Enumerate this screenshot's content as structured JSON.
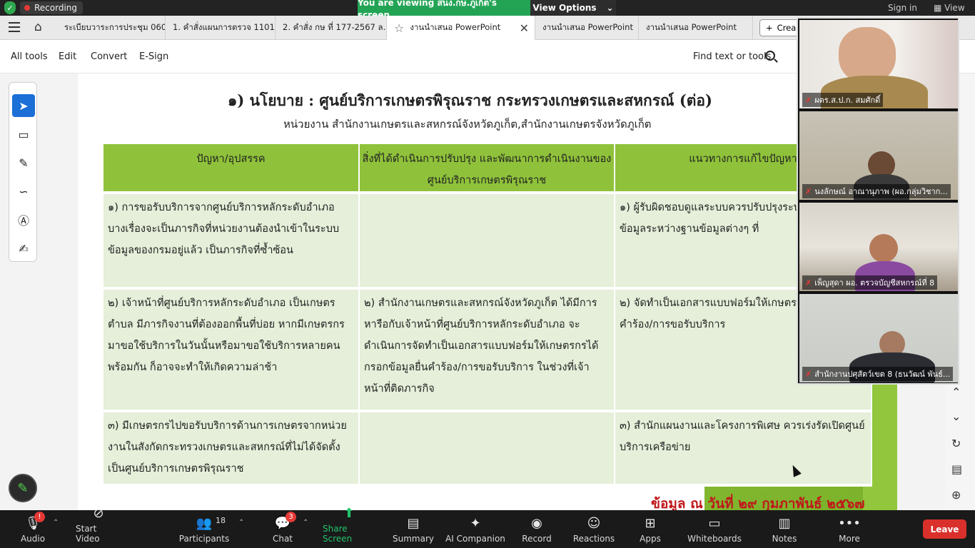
{
  "zoom_top": {
    "recording_label": "Recording",
    "viewing_text": "You are viewing สนง.กษ.ภูเก็ต's screen",
    "view_options_label": "View Options",
    "sign_in": "Sign in",
    "view_label": "View"
  },
  "browser_tabs": [
    {
      "label": "ระเบียบวาระการประชุม 060..."
    },
    {
      "label": "1. คำสั่งแผนการตรวจ 1101..."
    },
    {
      "label": "2. คำสั่ง กษ ที่ 177-2567 ล..."
    },
    {
      "label": "งานนำเสนอ PowerPoint"
    },
    {
      "label": "งานนำเสนอ PowerPoint"
    },
    {
      "label": "งานนำเสนอ PowerPoint"
    }
  ],
  "new_tab_label": "Crea",
  "menu": {
    "all_tools": "All tools",
    "edit": "Edit",
    "convert": "Convert",
    "esign": "E-Sign",
    "find": "Find text or tools"
  },
  "slide": {
    "title": "๑) นโยบาย : ศูนย์บริการเกษตรพิรุณราช กระทรวงเกษตรและสหกรณ์ (ต่อ)",
    "subtitle": "หน่วยงาน สำนักงานเกษตรและสหกรณ์จังหวัดภูเก็ต,สำนักงานเกษตรจังหวัดภูเก็ต",
    "headers": [
      "ปัญหา/อุปสรรค",
      "สิ่งที่ได้ดำเนินการปรับปรุง และพัฒนาการดำเนินงานของศูนย์บริการเกษตรพิรุณราช",
      "แนวทางการแก้ไขปัญหา"
    ],
    "rows": [
      [
        "๑) การขอรับบริการจากศูนย์บริการหลักระดับอำเภอ บางเรื่องจะเป็นภารกิจที่หน่วยงานต้องนำเข้าในระบบข้อมูลของกรมอยู่แล้ว เป็นภารกิจที่ซ้ำซ้อน",
        "",
        "๑) ผู้รับผิดชอบดูแลระบบควรปรับปรุงระบบ เชื่อมโยงข้อมูลระหว่างฐานข้อมูลต่างๆ ที่"
      ],
      [
        "๒) เจ้าหน้าที่ศูนย์บริการหลักระดับอำเภอ เป็นเกษตรตำบล มีภารกิจงานที่ต้องออกพื้นที่บ่อย หากมีเกษตรกรมาขอใช้บริการในวันนั้นหรือมาขอใช้บริการหลายคนพร้อมกัน ก็อาจจะทำให้เกิดความล่าช้า",
        "๒) สำนักงานเกษตรและสหกรณ์จังหวัดภูเก็ต ได้มีการหารือกับเจ้าหน้าที่ศูนย์บริการหลักระดับอำเภอ จะดำเนินการจัดทำเป็นเอกสารแบบฟอร์มให้เกษตรกรได้กรอกข้อมูลยื่นคำร้อง/การขอรับบริการ ในช่วงที่เจ้าหน้าที่ติดภารกิจ",
        "๒) จัดทำเป็นเอกสารแบบฟอร์มให้เกษตรกร ข้อมูลยื่นคำร้อง/การขอรับบริการ"
      ],
      [
        "๓) มีเกษตรกรไปขอรับบริการด้านการเกษตรจากหน่วยงานในสังกัดกระทรวงเกษตรและสหกรณ์ที่ไม่ได้จัดตั้งเป็นศูนย์บริการเกษตรพิรุณราช",
        "",
        "๓) สำนักแผนงานและโครงการพิเศษ ควรเร่งรัดเปิดศูนย์บริการเครือข่าย"
      ]
    ],
    "date": "ข้อมูล ณ วันที่ ๒๙ กุมภาพันธ์ ๒๕๖๗"
  },
  "participants": [
    {
      "name": "ผตร.ส.ป.ก. สมศักดิ์"
    },
    {
      "name": "นงลักษณ์ อาณานุภาพ (ผอ.กลุ่มวิชาก..."
    },
    {
      "name": "เพ็ญสุดา ผอ. ตรวจบัญชีสหกรณ์ที่ 8"
    },
    {
      "name": "สำนักงานปศุสัตว์เขต 8 (ธนวัฒน์ พันธ์..."
    }
  ],
  "bottom": {
    "audio": "Audio",
    "start_video": "Start Video",
    "participants": "Participants",
    "participants_count": "18",
    "chat": "Chat",
    "chat_count": "3",
    "audio_alert": "!",
    "share": "Share Screen",
    "summary": "Summary",
    "companion": "AI Companion",
    "record": "Record",
    "reactions": "Reactions",
    "apps": "Apps",
    "whiteboards": "Whiteboards",
    "notes": "Notes",
    "more": "More",
    "leave": "Leave"
  }
}
